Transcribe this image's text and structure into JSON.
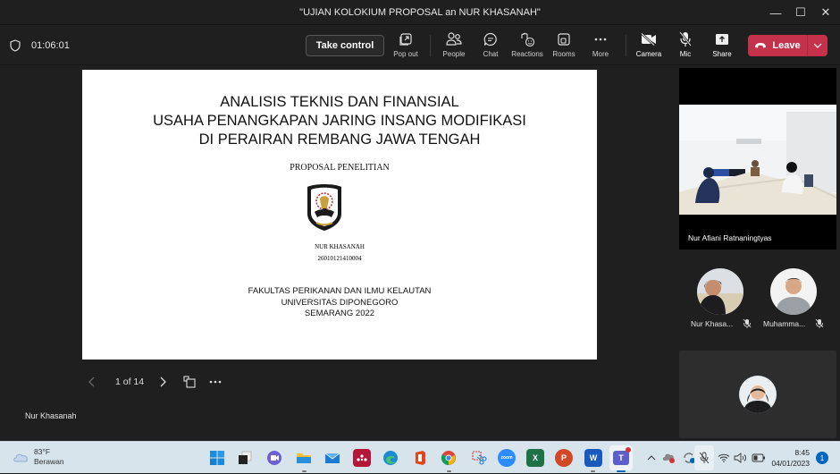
{
  "window": {
    "title": "\"UJIAN KOLOKIUM PROPOSAL an NUR KHASANAH\"",
    "controls": {
      "minimize": "—",
      "maximize": "☐",
      "close": "✕"
    }
  },
  "toolbar": {
    "timer": "01:06:01",
    "take_control": "Take control",
    "buttons": [
      {
        "id": "pop-out",
        "label": "Pop out",
        "icon": "pop-out-icon"
      },
      {
        "id": "people",
        "label": "People",
        "icon": "people-icon"
      },
      {
        "id": "chat",
        "label": "Chat",
        "icon": "chat-icon"
      },
      {
        "id": "reactions",
        "label": "Reactions",
        "icon": "reactions-icon"
      },
      {
        "id": "rooms",
        "label": "Rooms",
        "icon": "rooms-icon"
      },
      {
        "id": "more",
        "label": "More",
        "icon": "more-icon"
      },
      {
        "id": "camera",
        "label": "Camera",
        "icon": "camera-off-icon"
      },
      {
        "id": "mic",
        "label": "Mic",
        "icon": "mic-off-icon"
      },
      {
        "id": "share",
        "label": "Share",
        "icon": "share-icon"
      }
    ],
    "leave": "Leave",
    "leave_color": "#c4314b"
  },
  "slide": {
    "title_lines": [
      "ANALISIS TEKNIS DAN FINANSIAL",
      "USAHA PENANGKAPAN JARING INSANG MODIFIKASI",
      "DI PERAIRAN REMBANG JAWA TENGAH"
    ],
    "subtitle": "PROPOSAL PENELITIAN",
    "logo_text_top": "UNIVERSITAS DIPONEGORO",
    "logo_text_bottom": "SEMARANG",
    "author": "NUR KHASANAH",
    "student_id": "26010121410004",
    "institution_lines": [
      "FAKULTAS PERIKANAN DAN ILMU KELAUTAN",
      "UNIVERSITAS DIPONEGORO",
      "SEMARANG 2022"
    ]
  },
  "pager": {
    "current": "1 of 14"
  },
  "presenter_name": "Nur Khasanah",
  "participants": {
    "video": {
      "name": "Nur Afiani Ratnaningtyas"
    },
    "tiles": [
      {
        "name": "Nur Khasa...",
        "muted": true
      },
      {
        "name": "Muhamma...",
        "muted": true
      }
    ]
  },
  "taskbar": {
    "weather": {
      "temp": "83°F",
      "condition": "Berawan"
    },
    "apps": [
      {
        "name": "start",
        "label": ""
      },
      {
        "name": "task-view",
        "label": ""
      },
      {
        "name": "teams-chat",
        "label": ""
      },
      {
        "name": "file-explorer",
        "label": ""
      },
      {
        "name": "mail",
        "label": ""
      },
      {
        "name": "mendeley",
        "label": ""
      },
      {
        "name": "edge",
        "label": ""
      },
      {
        "name": "office",
        "label": ""
      },
      {
        "name": "chrome",
        "label": ""
      },
      {
        "name": "snipping-tool",
        "label": ""
      },
      {
        "name": "zoom",
        "label": "zoom"
      },
      {
        "name": "excel",
        "label": "X"
      },
      {
        "name": "powerpoint",
        "label": "P"
      },
      {
        "name": "word",
        "label": "W"
      },
      {
        "name": "teams",
        "label": "T"
      }
    ],
    "time": "8:45",
    "date": "04/01/2023",
    "notifications": "1"
  }
}
